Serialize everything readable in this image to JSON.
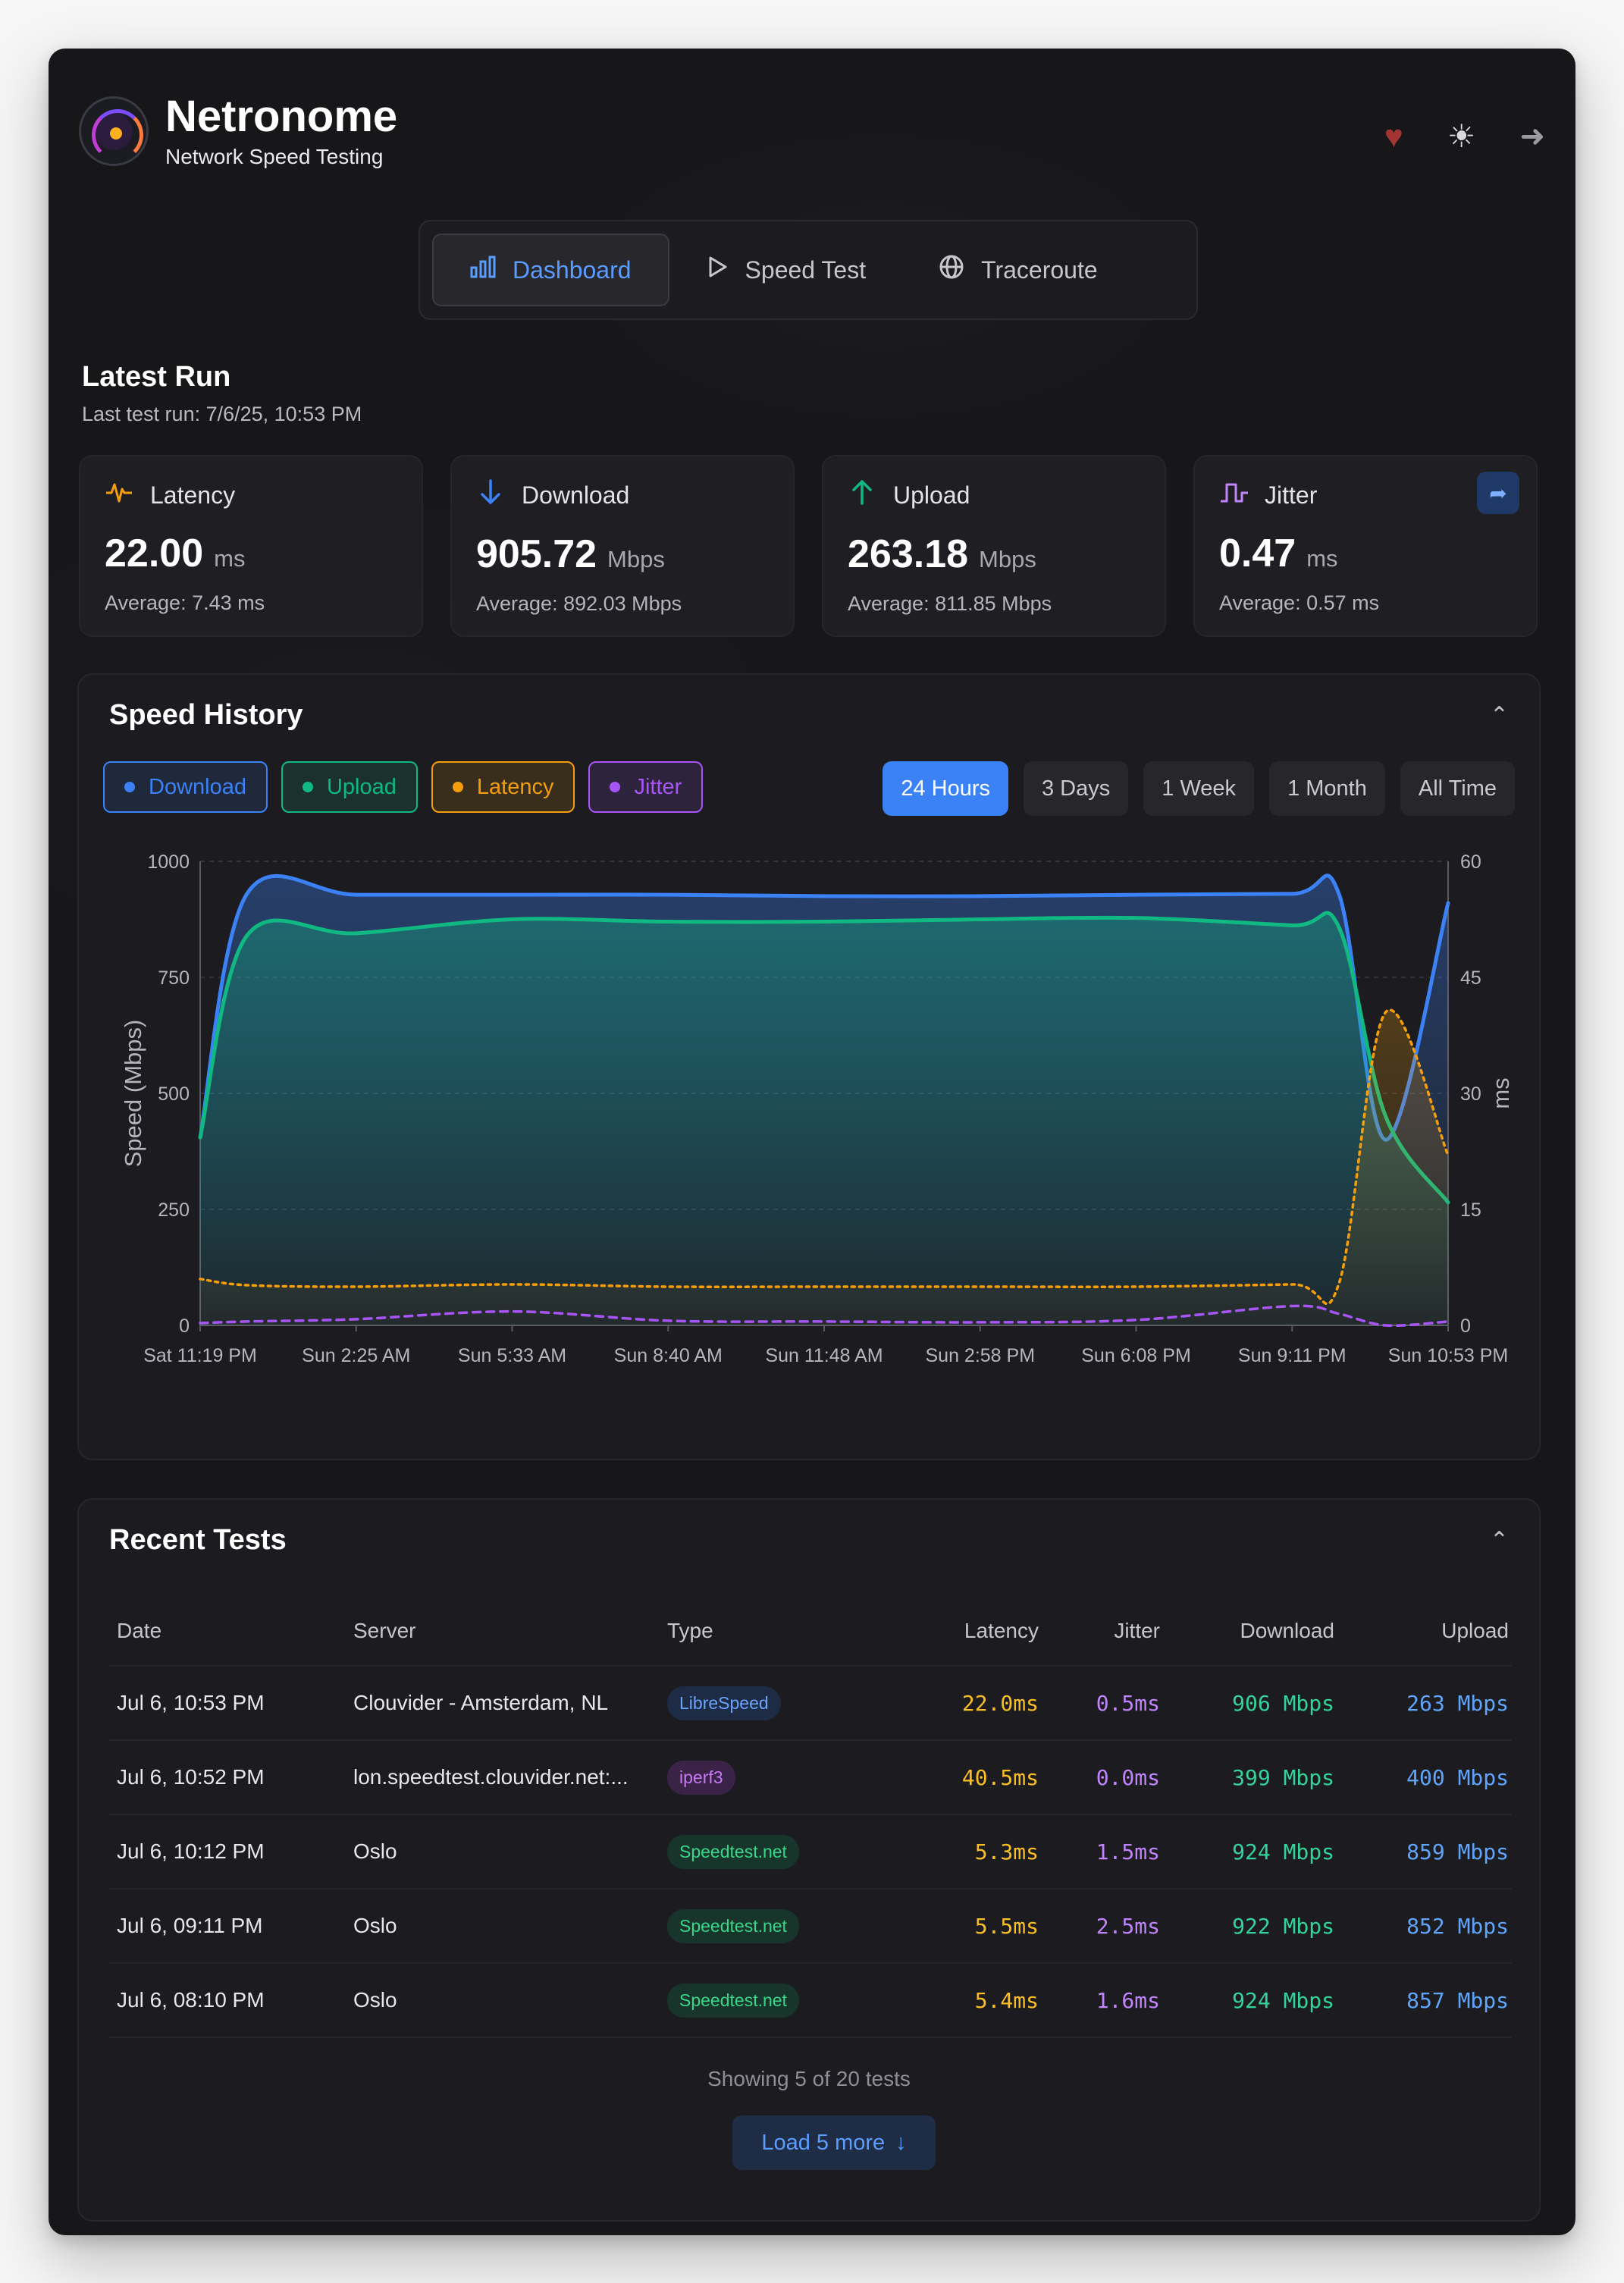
{
  "app": {
    "title": "Netronome",
    "subtitle": "Network Speed Testing"
  },
  "icons": {
    "heart": "heart-icon",
    "theme": "sun-icon",
    "logout": "logout-icon"
  },
  "nav": {
    "items": [
      {
        "label": "Dashboard",
        "icon": "bar-chart-icon",
        "active": true
      },
      {
        "label": "Speed Test",
        "icon": "play-icon",
        "active": false
      },
      {
        "label": "Traceroute",
        "icon": "globe-icon",
        "active": false
      }
    ]
  },
  "latest": {
    "title": "Latest Run",
    "last_run": "Last test run: 7/6/25, 10:53 PM",
    "cards": [
      {
        "label": "Latency",
        "value": "22.00",
        "unit": "ms",
        "average": "Average: 7.43 ms",
        "color": "#f59e0b",
        "icon": "activity-icon"
      },
      {
        "label": "Download",
        "value": "905.72",
        "unit": "Mbps",
        "average": "Average: 892.03 Mbps",
        "color": "#3b82f6",
        "icon": "arrow-down-icon"
      },
      {
        "label": "Upload",
        "value": "263.18",
        "unit": "Mbps",
        "average": "Average: 811.85 Mbps",
        "color": "#10b981",
        "icon": "arrow-up-icon"
      },
      {
        "label": "Jitter",
        "value": "0.47",
        "unit": "ms",
        "average": "Average: 0.57 ms",
        "color": "#c084fc",
        "icon": "pulse-icon"
      }
    ]
  },
  "history": {
    "title": "Speed History",
    "legend": [
      {
        "label": "Download",
        "color": "#3b82f6"
      },
      {
        "label": "Upload",
        "color": "#10b981"
      },
      {
        "label": "Latency",
        "color": "#f59e0b"
      },
      {
        "label": "Jitter",
        "color": "#a855f7"
      }
    ],
    "ranges": [
      {
        "label": "24 Hours",
        "active": true
      },
      {
        "label": "3 Days",
        "active": false
      },
      {
        "label": "1 Week",
        "active": false
      },
      {
        "label": "1 Month",
        "active": false
      },
      {
        "label": "All Time",
        "active": false
      }
    ]
  },
  "chart_data": {
    "type": "line",
    "ylabel": "Speed (Mbps)",
    "y2label": "ms",
    "ylim": [
      0,
      1000
    ],
    "y2lim": [
      0,
      60
    ],
    "yticks": [
      0,
      250,
      500,
      750,
      1000
    ],
    "y2ticks": [
      0,
      15,
      30,
      45,
      60
    ],
    "grid": true,
    "x_ticks": [
      "Sat 11:19 PM",
      "Sun 2:25 AM",
      "Sun 5:33 AM",
      "Sun 8:40 AM",
      "Sun 11:48 AM",
      "Sun 2:58 PM",
      "Sun 6:08 PM",
      "Sun 9:11 PM",
      "Sun 10:53 PM"
    ],
    "x": [
      0,
      0.3,
      1,
      2,
      3,
      4,
      5,
      6,
      7,
      7.3,
      7.6,
      8
    ],
    "series": [
      {
        "name": "Download",
        "axis": "left",
        "color": "#3b82f6",
        "values": [
          405,
          930,
          928,
          928,
          928,
          925,
          925,
          928,
          930,
          930,
          400,
          910
        ]
      },
      {
        "name": "Upload",
        "axis": "left",
        "color": "#10b981",
        "values": [
          405,
          840,
          845,
          875,
          870,
          870,
          875,
          878,
          862,
          858,
          450,
          265
        ]
      },
      {
        "name": "Latency",
        "axis": "right",
        "color": "#f59e0b",
        "values": [
          6.0,
          5.2,
          5.0,
          5.3,
          5.0,
          5.0,
          5.0,
          5.0,
          5.3,
          5.4,
          40.5,
          22.0
        ]
      },
      {
        "name": "Jitter",
        "axis": "right",
        "color": "#a855f7",
        "values": [
          0.3,
          0.5,
          0.8,
          1.8,
          0.6,
          0.5,
          0.4,
          0.7,
          2.5,
          1.5,
          0.0,
          0.5
        ]
      }
    ]
  },
  "recent": {
    "title": "Recent Tests",
    "columns": {
      "date": "Date",
      "server": "Server",
      "type": "Type",
      "latency": "Latency",
      "jitter": "Jitter",
      "download": "Download",
      "upload": "Upload"
    },
    "rows": [
      {
        "date": "Jul 6, 10:53 PM",
        "server": "Clouvider - Amsterdam, NL",
        "type": "LibreSpeed",
        "type_class": "ls",
        "latency": "22.0ms",
        "jitter": "0.5ms",
        "download": "906 Mbps",
        "upload": "263 Mbps"
      },
      {
        "date": "Jul 6, 10:52 PM",
        "server": "lon.speedtest.clouvider.net:...",
        "type": "iperf3",
        "type_class": "ip",
        "latency": "40.5ms",
        "jitter": "0.0ms",
        "download": "399 Mbps",
        "upload": "400 Mbps"
      },
      {
        "date": "Jul 6, 10:12 PM",
        "server": "Oslo",
        "type": "Speedtest.net",
        "type_class": "st",
        "latency": "5.3ms",
        "jitter": "1.5ms",
        "download": "924 Mbps",
        "upload": "859 Mbps"
      },
      {
        "date": "Jul 6, 09:11 PM",
        "server": "Oslo",
        "type": "Speedtest.net",
        "type_class": "st",
        "latency": "5.5ms",
        "jitter": "2.5ms",
        "download": "922 Mbps",
        "upload": "852 Mbps"
      },
      {
        "date": "Jul 6, 08:10 PM",
        "server": "Oslo",
        "type": "Speedtest.net",
        "type_class": "st",
        "latency": "5.4ms",
        "jitter": "1.6ms",
        "download": "924 Mbps",
        "upload": "857 Mbps"
      }
    ],
    "showing": "Showing 5 of 20 tests",
    "load_more": "Load 5 more"
  }
}
